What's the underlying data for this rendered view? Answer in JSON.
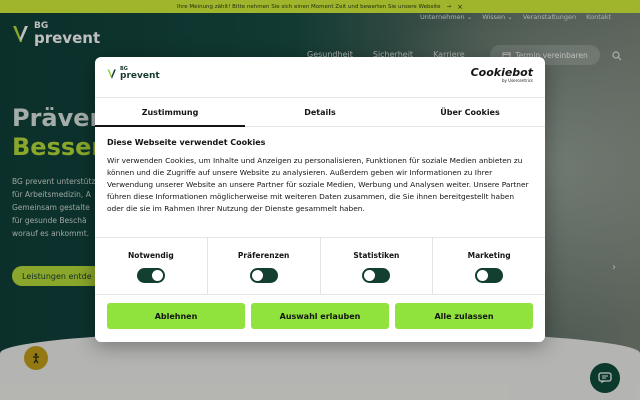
{
  "announcement": {
    "text": "Ihre Meinung zählt! Bitte nehmen Sie sich einen Moment Zeit und bewerten Sie unsere Website",
    "arrow": "→",
    "close": "×"
  },
  "site": {
    "logo_top": "BG",
    "logo_bottom": "prevent",
    "top_nav": [
      "Unternehmen ⌄",
      "Wissen ⌄",
      "Veranstaltungen",
      "Kontakt"
    ],
    "main_nav": [
      "Gesundheit",
      "Sicherheit",
      "Karriere"
    ],
    "appointment_button": "Termin vereinbaren",
    "hero_title_1": "Präventi",
    "hero_title_2": "Besser",
    "hero_text": [
      "BG prevent unterstützt",
      "für Arbeitsmedizin, A",
      "Gemeinsam gestalte",
      "für gesunde Beschä",
      "worauf es ankommt."
    ],
    "cta": "Leistungen entde",
    "next_arrow": "›"
  },
  "cookie_dialog": {
    "logo_top": "BG",
    "logo_bottom": "prevent",
    "brand": "Cookiebot",
    "brand_sub": "by Usercentrics",
    "tabs": [
      {
        "label": "Zustimmung",
        "active": true
      },
      {
        "label": "Details",
        "active": false
      },
      {
        "label": "Über Cookies",
        "active": false
      }
    ],
    "heading": "Diese Webseite verwendet Cookies",
    "body": "Wir verwenden Cookies, um Inhalte und Anzeigen zu personalisieren, Funktionen für soziale Medien anbieten zu können und die Zugriffe auf unsere Website zu analysieren. Außerdem geben wir Informationen zu Ihrer Verwendung unserer Website an unsere Partner für soziale Medien, Werbung und Analysen weiter. Unsere Partner führen diese Informationen möglicherweise mit weiteren Daten zusammen, die Sie ihnen bereitgestellt haben oder die sie im Rahmen Ihrer Nutzung der Dienste gesammelt haben.",
    "preferences": [
      {
        "label": "Notwendig",
        "state": "on"
      },
      {
        "label": "Präferenzen",
        "state": "off"
      },
      {
        "label": "Statistiken",
        "state": "off"
      },
      {
        "label": "Marketing",
        "state": "off"
      }
    ],
    "buttons": {
      "deny": "Ablehnen",
      "allow_selection": "Auswahl erlauben",
      "allow_all": "Alle zulassen"
    }
  },
  "colors": {
    "accent_green": "#8fe33c",
    "dark_green": "#123f30",
    "announce_yellow": "#d6f23a"
  }
}
